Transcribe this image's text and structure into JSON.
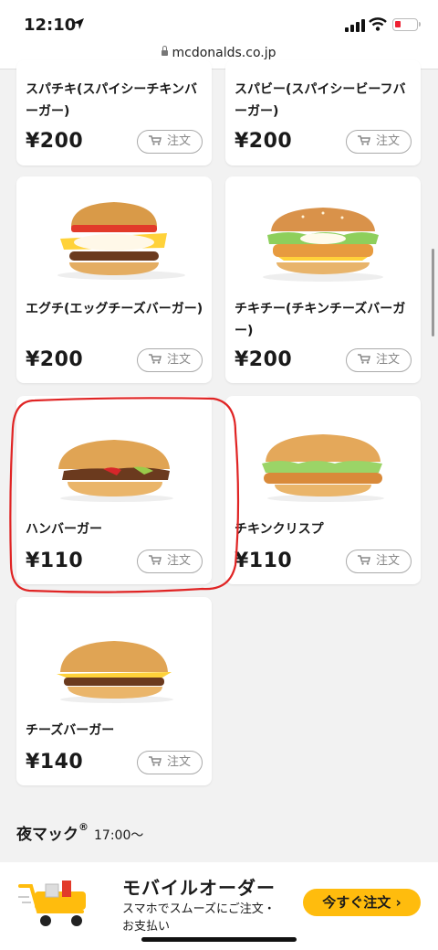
{
  "status_bar": {
    "time": "12:10"
  },
  "browser": {
    "url": "mcdonalds.co.jp"
  },
  "products": [
    {
      "name": "スパチキ(スパイシーチキンバーガー)",
      "price": "¥200",
      "order_label": "注文"
    },
    {
      "name": "スパビー(スパイシービーフバーガー)",
      "price": "¥200",
      "order_label": "注文"
    },
    {
      "name": "エグチ(エッグチーズバーガー)",
      "price": "¥200",
      "order_label": "注文"
    },
    {
      "name": "チキチー(チキンチーズバーガー)",
      "price": "¥200",
      "order_label": "注文"
    },
    {
      "name": "ハンバーガー",
      "price": "¥110",
      "order_label": "注文"
    },
    {
      "name": "チキンクリスプ",
      "price": "¥110",
      "order_label": "注文"
    },
    {
      "name": "チーズバーガー",
      "price": "¥140",
      "order_label": "注文"
    }
  ],
  "section": {
    "title": "夜マック",
    "registered": "®",
    "hours": "17:00〜"
  },
  "banner": {
    "title": "モバイルオーダー",
    "subtitle": "スマホでスムーズにご注文・お支払い",
    "button_label": "今すぐ注文"
  },
  "colors": {
    "accent": "#ffbc0d",
    "highlight_circle": "#e02424"
  }
}
